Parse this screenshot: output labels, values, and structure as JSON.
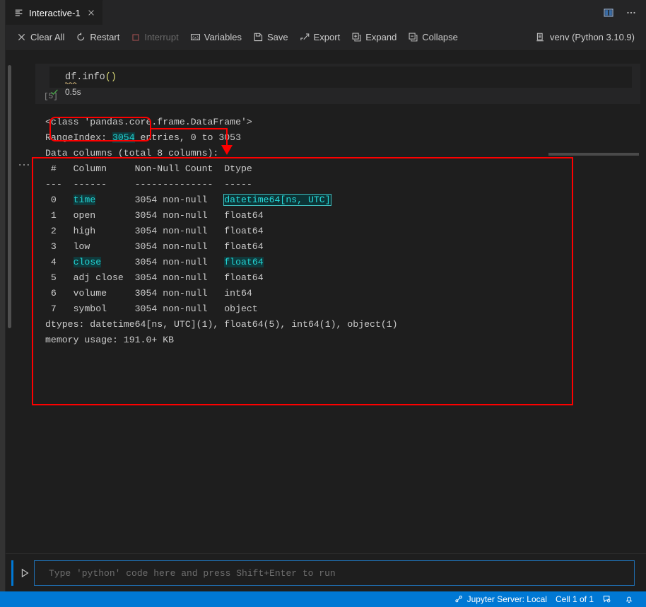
{
  "window": {
    "theme_bg": "#1e1e1e",
    "accent": "#0078d4",
    "annotation_color": "#fe0000"
  },
  "tab": {
    "label": "Interactive-1",
    "icon": "interactive-window-icon",
    "close_icon": "close-icon"
  },
  "tabbar_actions": [
    {
      "name": "split-editor-icon",
      "label": "Split Editor"
    },
    {
      "name": "more-actions-icon",
      "label": "More Actions..."
    }
  ],
  "toolbar": {
    "buttons": [
      {
        "label": "Clear All",
        "icon": "clear-all-icon",
        "disabled": false
      },
      {
        "label": "Restart",
        "icon": "restart-icon",
        "disabled": false
      },
      {
        "label": "Interrupt",
        "icon": "interrupt-icon",
        "disabled": true
      },
      {
        "label": "Variables",
        "icon": "variables-icon",
        "disabled": false
      },
      {
        "label": "Save",
        "icon": "save-icon",
        "disabled": false
      },
      {
        "label": "Export",
        "icon": "export-icon",
        "disabled": false
      },
      {
        "label": "Expand",
        "icon": "expand-icon",
        "disabled": false
      },
      {
        "label": "Collapse",
        "icon": "collapse-icon",
        "disabled": false
      }
    ],
    "kernel": {
      "label": "venv (Python 3.10.9)",
      "icon": "kernel-icon"
    }
  },
  "cell": {
    "execution_label": "[5]",
    "code": {
      "variable": "df",
      "dot": ".",
      "method": "info",
      "parens": "()"
    },
    "run_status": {
      "icon": "check-icon",
      "duration": "0.5s"
    },
    "output_collapse_icon": "output-ellipsis-icon"
  },
  "output": {
    "lines": [
      {
        "segments": [
          {
            "t": "<class 'pandas.core.frame.DataFrame'>",
            "h": "none"
          }
        ]
      },
      {
        "segments": [
          {
            "t": "RangeIndex: ",
            "h": "none"
          },
          {
            "t": "3054",
            "h": "match"
          },
          {
            "t": " entries, 0 to 3053",
            "h": "none"
          }
        ]
      },
      {
        "segments": [
          {
            "t": "Data columns (total 8 columns):",
            "h": "none"
          }
        ]
      },
      {
        "segments": [
          {
            "t": " #   Column     Non-Null Count  Dtype",
            "h": "none"
          }
        ]
      },
      {
        "segments": [
          {
            "t": "---  ------     --------------  -----",
            "h": "none"
          }
        ]
      },
      {
        "segments": [
          {
            "t": " 0   ",
            "h": "none"
          },
          {
            "t": "time",
            "h": "match"
          },
          {
            "t": "       3054 non-null   ",
            "h": "none"
          },
          {
            "t": "datetime64[ns, UTC]",
            "h": "current"
          }
        ]
      },
      {
        "segments": [
          {
            "t": " 1   open       3054 non-null   float64",
            "h": "none"
          }
        ]
      },
      {
        "segments": [
          {
            "t": " 2   high       3054 non-null   float64",
            "h": "none"
          }
        ]
      },
      {
        "segments": [
          {
            "t": " 3   low        3054 non-null   float64",
            "h": "none"
          }
        ]
      },
      {
        "segments": [
          {
            "t": " 4   ",
            "h": "none"
          },
          {
            "t": "close",
            "h": "match"
          },
          {
            "t": "      3054 non-null   ",
            "h": "none"
          },
          {
            "t": "float64",
            "h": "match"
          }
        ]
      },
      {
        "segments": [
          {
            "t": " 5   adj close  3054 non-null   float64",
            "h": "none"
          }
        ]
      },
      {
        "segments": [
          {
            "t": " 6   volume     3054 non-null   int64",
            "h": "none"
          }
        ]
      },
      {
        "segments": [
          {
            "t": " 7   symbol     3054 non-null   object",
            "h": "none"
          }
        ]
      },
      {
        "segments": [
          {
            "t": "dtypes: datetime64[ns, UTC](1), float64(5), int64(1), object(1)",
            "h": "none"
          }
        ]
      },
      {
        "segments": [
          {
            "t": "memory usage: 191.0+ KB",
            "h": "none"
          }
        ]
      }
    ]
  },
  "input_dock": {
    "run_icon": "run-cell-icon",
    "placeholder": "Type 'python' code here and press Shift+Enter to run",
    "value": ""
  },
  "statusbar": {
    "items": [
      {
        "label": "Jupyter Server: Local",
        "icon": "jupyter-server-icon"
      },
      {
        "label": "Cell 1 of 1",
        "icon": ""
      },
      {
        "label": "",
        "icon": "feedback-icon"
      },
      {
        "label": "",
        "icon": "bell-icon"
      }
    ]
  }
}
